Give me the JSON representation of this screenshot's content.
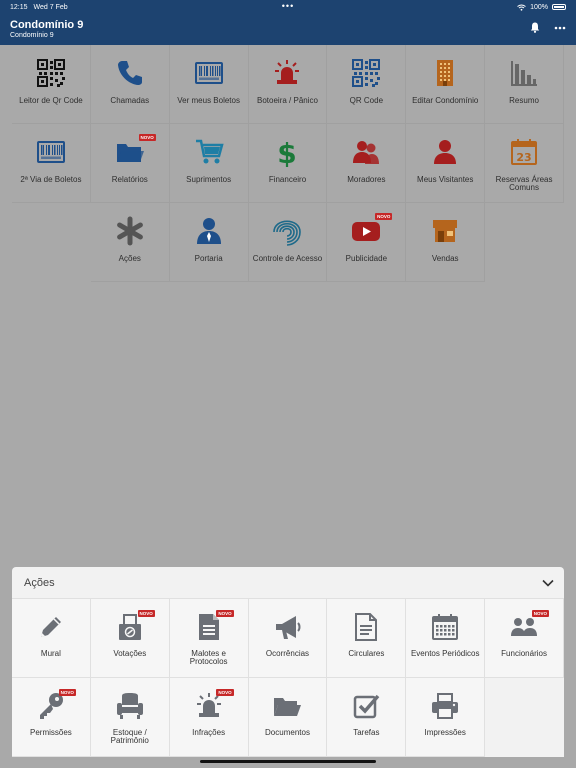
{
  "status": {
    "time": "12:15",
    "date": "Wed 7 Feb",
    "dots": "•••",
    "battery": "100%"
  },
  "header": {
    "title": "Condomínio 9",
    "subtitle": "Condomínio 9"
  },
  "badge_label": "NOVO",
  "colors": {
    "appbar": "#1d4370",
    "badge": "#c62828",
    "overlay": "#a9a9a9",
    "sheet": "#f2f2f2"
  },
  "grid": [
    {
      "label": "Leitor de Qr Code",
      "icon": "qr-scan-icon",
      "color": "#111111"
    },
    {
      "label": "Chamadas",
      "icon": "phone-icon",
      "color": "#1e4f8a"
    },
    {
      "label": "Ver meus Boletos",
      "icon": "barcode-icon",
      "color": "#1e4f8a"
    },
    {
      "label": "Botoeira / Pânico",
      "icon": "siren-icon",
      "color": "#a51e1e"
    },
    {
      "label": "QR Code",
      "icon": "qr-code-icon",
      "color": "#1e4f8a"
    },
    {
      "label": "Editar Condomínio",
      "icon": "building-icon",
      "color": "#b5651d"
    },
    {
      "label": "Resumo",
      "icon": "bar-chart-icon",
      "color": "#666666"
    },
    {
      "label": "2ª Via de Boletos",
      "icon": "barcode-icon",
      "color": "#1e4f8a"
    },
    {
      "label": "Relatórios",
      "icon": "folder-icon",
      "color": "#1e4f8a",
      "badge": true
    },
    {
      "label": "Suprimentos",
      "icon": "cart-icon",
      "color": "#1e7ea5"
    },
    {
      "label": "Financeiro",
      "icon": "dollar-icon",
      "color": "#1b7a3a"
    },
    {
      "label": "Moradores",
      "icon": "people-icon",
      "color": "#a51e1e"
    },
    {
      "label": "Meus Visitantes",
      "icon": "person-icon",
      "color": "#a51e1e"
    },
    {
      "label": "Reservas Áreas Comuns",
      "icon": "calendar-icon",
      "color": "#b5651d"
    },
    {
      "label": "",
      "icon": "",
      "blank": true
    },
    {
      "label": "Ações",
      "icon": "asterisk-icon",
      "color": "#555555"
    },
    {
      "label": "Portaria",
      "icon": "guard-icon",
      "color": "#1e4f8a"
    },
    {
      "label": "Controle de Acesso",
      "icon": "fingerprint-icon",
      "color": "#1e6a8a"
    },
    {
      "label": "Publicidade",
      "icon": "youtube-icon",
      "color": "#a51e1e",
      "badge": true
    },
    {
      "label": "Vendas",
      "icon": "store-icon",
      "color": "#b5651d"
    }
  ],
  "sheet": {
    "title": "Ações",
    "items": [
      {
        "label": "Mural",
        "icon": "pencil-icon"
      },
      {
        "label": "Votações",
        "icon": "ballot-icon",
        "badge": true
      },
      {
        "label": "Malotes e Protocolos",
        "icon": "document-icon",
        "badge": true
      },
      {
        "label": "Ocorrências",
        "icon": "megaphone-icon"
      },
      {
        "label": "Circulares",
        "icon": "file-icon"
      },
      {
        "label": "Eventos Periódicos",
        "icon": "calendar-grid-icon"
      },
      {
        "label": "Funcionários",
        "icon": "users-icon",
        "badge": true
      },
      {
        "label": "Permissões",
        "icon": "key-icon",
        "badge": true
      },
      {
        "label": "Estoque / Patrimônio",
        "icon": "armchair-icon"
      },
      {
        "label": "Infrações",
        "icon": "alarm-icon",
        "badge": true
      },
      {
        "label": "Documentos",
        "icon": "folder-open-icon"
      },
      {
        "label": "Tarefas",
        "icon": "checkbox-icon"
      },
      {
        "label": "Impressões",
        "icon": "printer-icon"
      }
    ]
  }
}
